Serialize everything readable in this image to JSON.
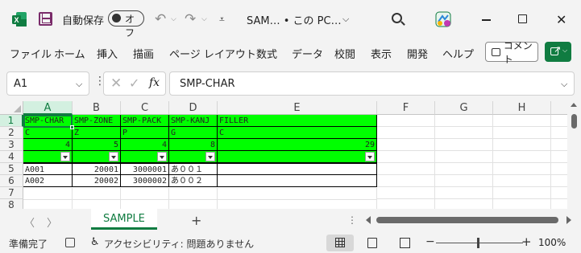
{
  "titlebar": {
    "autosave_label": "自動保存",
    "autosave_toggle": "オフ",
    "qat_more": "⩡",
    "doc_title": "SAM… • この PC…",
    "doc_dropdown": "⌵"
  },
  "ribbon": {
    "tabs": [
      "ファイル",
      "ホーム",
      "挿入",
      "描画",
      "ページ レイアウト",
      "数式",
      "データ",
      "校閲",
      "表示",
      "開発",
      "ヘルプ"
    ],
    "comment_label": "コメント"
  },
  "formula_bar": {
    "name_box": "A1",
    "fx": "fx",
    "content": "SMP-CHAR"
  },
  "grid": {
    "columns": [
      "A",
      "B",
      "C",
      "D",
      "E",
      "F",
      "G",
      "H"
    ],
    "rows": [
      "1",
      "2",
      "3",
      "4",
      "5",
      "6",
      "7",
      "8"
    ],
    "cells": {
      "A1": "SMP-CHAR",
      "B1": "SMP-ZONE",
      "C1": "SMP-PACK",
      "D1": "SMP-KANJ",
      "E1": "FILLER",
      "A2": "C",
      "B2": "Z",
      "C2": "P",
      "D2": "G",
      "E2": "C",
      "A3": "4",
      "B3": "5",
      "C3": "4",
      "D3": "8",
      "E3": "29",
      "A5": "A001",
      "B5": "20001",
      "C5": "3000001",
      "D5": "あ００１",
      "A6": "A002",
      "B6": "20002",
      "C6": "3000002",
      "D6": "あ００２"
    },
    "highlight_color": "#00ff00"
  },
  "sheets": {
    "tabs": [
      "SAMPLE"
    ],
    "add_label": "+"
  },
  "status": {
    "ready": "準備完了",
    "accessibility": "アクセシビリティ: 問題ありません",
    "zoom": "100%"
  },
  "colors": {
    "accent": "#107c41"
  }
}
